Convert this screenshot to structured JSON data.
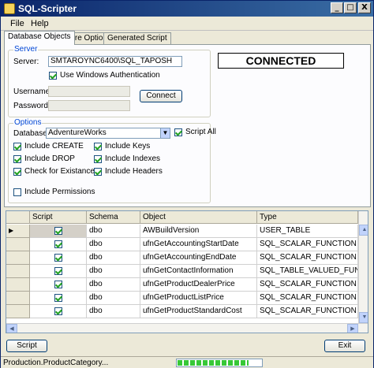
{
  "window": {
    "title": "SQL-Scripter",
    "min_glyph": "_",
    "max_glyph": "□",
    "close_glyph": "X"
  },
  "menu": {
    "file": "File",
    "help": "Help"
  },
  "tabs": [
    "Database Objects",
    "More Options",
    "Generated Script"
  ],
  "server_group": {
    "legend": "Server",
    "server_label": "Server:",
    "server_value": "SMTAROYNC6400\\SQL_TAPOSH",
    "windows_auth_label": "Use Windows Authentication",
    "windows_auth_checked": true,
    "username_label": "Username:",
    "password_label": "Password:",
    "connect_label": "Connect"
  },
  "status_box": "CONNECTED",
  "options_group": {
    "legend": "Options",
    "database_label": "Database:",
    "database_value": "AdventureWorks",
    "script_all_label": "Script All",
    "script_all_checked": true,
    "left_options": [
      {
        "label": "Include CREATE",
        "checked": true
      },
      {
        "label": "Include DROP",
        "checked": true
      },
      {
        "label": "Check for Existance",
        "checked": true
      },
      {
        "label": "Include Permissions",
        "checked": false
      }
    ],
    "right_options": [
      {
        "label": "Include Keys",
        "checked": true
      },
      {
        "label": "Include Indexes",
        "checked": true
      },
      {
        "label": "Include Headers",
        "checked": true
      }
    ]
  },
  "grid": {
    "columns": [
      "Script",
      "Schema",
      "Object",
      "Type"
    ],
    "rows": [
      {
        "script": true,
        "schema": "dbo",
        "object": "AWBuildVersion",
        "type": "USER_TABLE",
        "current": true
      },
      {
        "script": true,
        "schema": "dbo",
        "object": "ufnGetAccountingStartDate",
        "type": "SQL_SCALAR_FUNCTION",
        "current": false
      },
      {
        "script": true,
        "schema": "dbo",
        "object": "ufnGetAccountingEndDate",
        "type": "SQL_SCALAR_FUNCTION",
        "current": false
      },
      {
        "script": true,
        "schema": "dbo",
        "object": "ufnGetContactInformation",
        "type": "SQL_TABLE_VALUED_FUNCTION",
        "current": false
      },
      {
        "script": true,
        "schema": "dbo",
        "object": "ufnGetProductDealerPrice",
        "type": "SQL_SCALAR_FUNCTION",
        "current": false
      },
      {
        "script": true,
        "schema": "dbo",
        "object": "ufnGetProductListPrice",
        "type": "SQL_SCALAR_FUNCTION",
        "current": false
      },
      {
        "script": true,
        "schema": "dbo",
        "object": "ufnGetProductStandardCost",
        "type": "SQL_SCALAR_FUNCTION",
        "current": false
      }
    ]
  },
  "buttons": {
    "script": "Script",
    "exit": "Exit"
  },
  "statusbar": {
    "text": "Production.ProductCategory...",
    "progress": 0.85
  }
}
